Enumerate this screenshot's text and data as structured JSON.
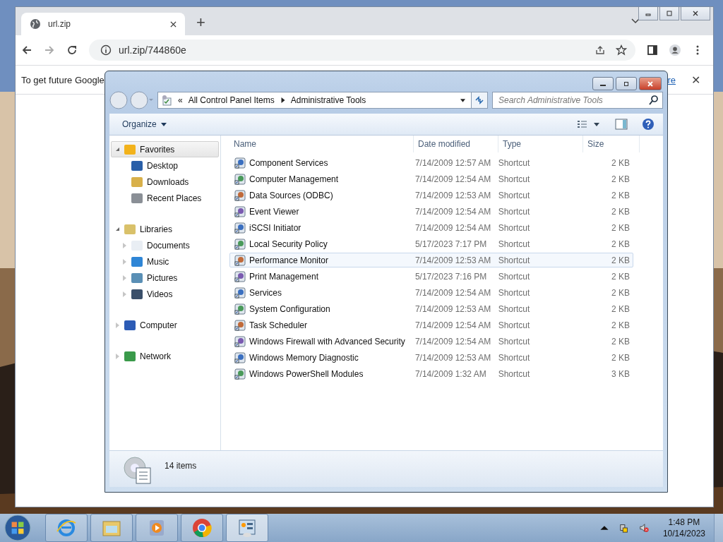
{
  "browser": {
    "tab": {
      "title": "url.zip"
    },
    "new_tab": "+",
    "address": "url.zip/744860e",
    "infobar": {
      "text": "To get future Google",
      "link": "re",
      "close": "✕"
    }
  },
  "explorer": {
    "breadcrumb": [
      "«",
      "All Control Panel Items",
      "Administrative Tools"
    ],
    "search": {
      "placeholder": "Search Administrative Tools"
    },
    "organize": "Organize",
    "nav": [
      {
        "label": "Favorites",
        "expanded": true,
        "selected": true,
        "children": [
          {
            "label": "Desktop",
            "selected": false
          },
          {
            "label": "Downloads",
            "selected": false
          },
          {
            "label": "Recent Places",
            "selected": false
          }
        ]
      },
      {
        "label": "Libraries",
        "expanded": true,
        "selected": false,
        "children": [
          {
            "label": "Documents",
            "expanded": false,
            "selected": false
          },
          {
            "label": "Music",
            "expanded": false,
            "selected": false
          },
          {
            "label": "Pictures",
            "expanded": false,
            "selected": false
          },
          {
            "label": "Videos",
            "expanded": false,
            "selected": false
          }
        ]
      },
      {
        "label": "Computer",
        "expanded": false,
        "selected": false
      },
      {
        "label": "Network",
        "expanded": false,
        "selected": false
      }
    ],
    "columns": [
      "Name",
      "Date modified",
      "Type",
      "Size"
    ],
    "rows": [
      {
        "name": "Component Services",
        "date": "7/14/2009 12:57 AM",
        "type": "Shortcut",
        "size": "2 KB",
        "highlighted": false
      },
      {
        "name": "Computer Management",
        "date": "7/14/2009 12:54 AM",
        "type": "Shortcut",
        "size": "2 KB",
        "highlighted": false
      },
      {
        "name": "Data Sources (ODBC)",
        "date": "7/14/2009 12:53 AM",
        "type": "Shortcut",
        "size": "2 KB",
        "highlighted": false
      },
      {
        "name": "Event Viewer",
        "date": "7/14/2009 12:54 AM",
        "type": "Shortcut",
        "size": "2 KB",
        "highlighted": false
      },
      {
        "name": "iSCSI Initiator",
        "date": "7/14/2009 12:54 AM",
        "type": "Shortcut",
        "size": "2 KB",
        "highlighted": false
      },
      {
        "name": "Local Security Policy",
        "date": "5/17/2023 7:17 PM",
        "type": "Shortcut",
        "size": "2 KB",
        "highlighted": false
      },
      {
        "name": "Performance Monitor",
        "date": "7/14/2009 12:53 AM",
        "type": "Shortcut",
        "size": "2 KB",
        "highlighted": true
      },
      {
        "name": "Print Management",
        "date": "5/17/2023 7:16 PM",
        "type": "Shortcut",
        "size": "2 KB",
        "highlighted": false
      },
      {
        "name": "Services",
        "date": "7/14/2009 12:54 AM",
        "type": "Shortcut",
        "size": "2 KB",
        "highlighted": false
      },
      {
        "name": "System Configuration",
        "date": "7/14/2009 12:53 AM",
        "type": "Shortcut",
        "size": "2 KB",
        "highlighted": false
      },
      {
        "name": "Task Scheduler",
        "date": "7/14/2009 12:54 AM",
        "type": "Shortcut",
        "size": "2 KB",
        "highlighted": false
      },
      {
        "name": "Windows Firewall with Advanced Security",
        "date": "7/14/2009 12:54 AM",
        "type": "Shortcut",
        "size": "2 KB",
        "highlighted": false
      },
      {
        "name": "Windows Memory Diagnostic",
        "date": "7/14/2009 12:53 AM",
        "type": "Shortcut",
        "size": "2 KB",
        "highlighted": false
      },
      {
        "name": "Windows PowerShell Modules",
        "date": "7/14/2009 1:32 AM",
        "type": "Shortcut",
        "size": "3 KB",
        "highlighted": false
      }
    ],
    "status": "14 items"
  },
  "taskbar": {
    "time": "1:48 PM",
    "date": "10/14/2023"
  }
}
